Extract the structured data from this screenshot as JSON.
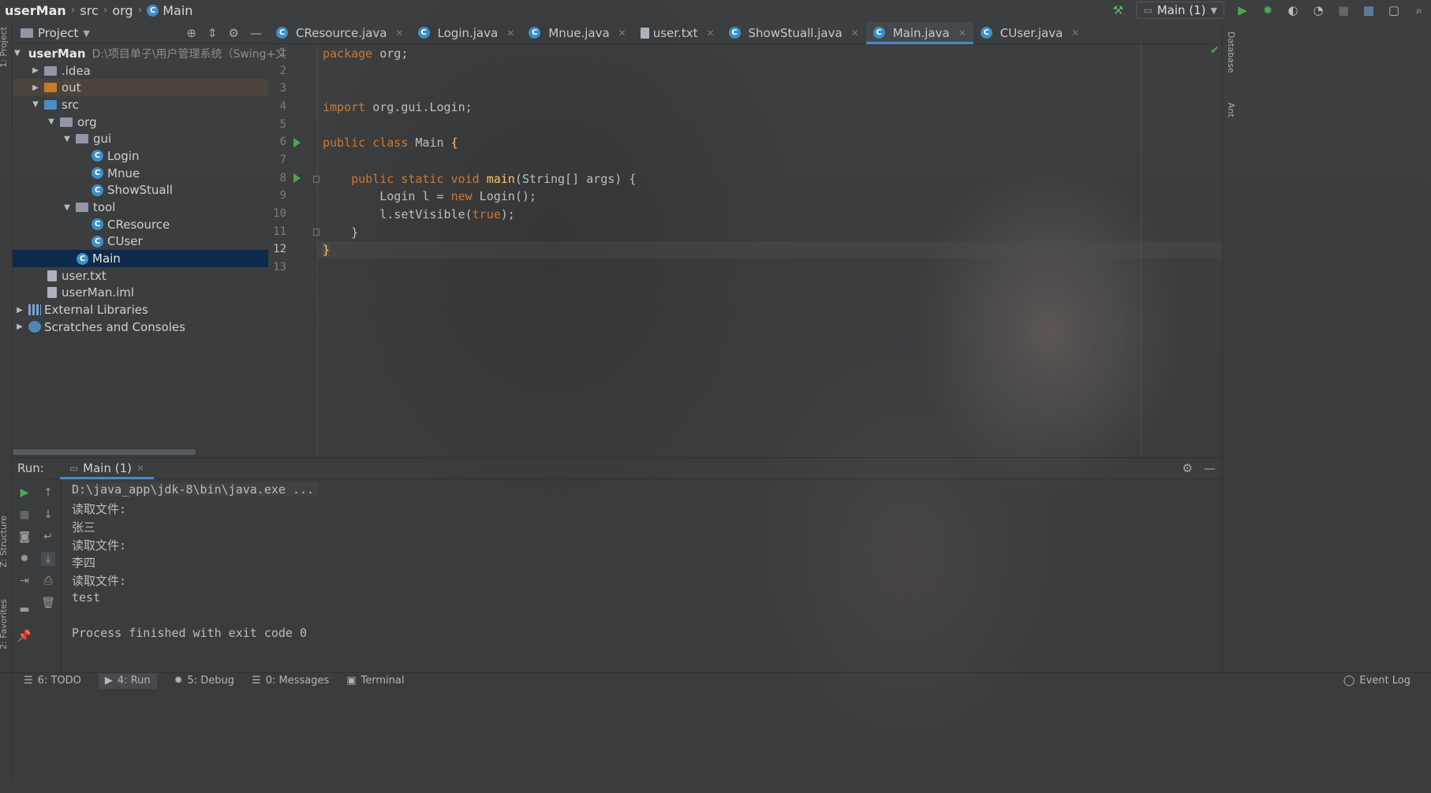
{
  "breadcrumb": {
    "project": "userMan",
    "p1": "src",
    "p2": "org",
    "p3": "Main"
  },
  "toolbar": {
    "run_config": "Main (1)"
  },
  "left_strip": {
    "project_label": "1: Project",
    "structure_label": "Z: Structure",
    "favorites_label": "2: Favorites"
  },
  "right_strip": {
    "database_label": "Database",
    "ant_label": "Ant"
  },
  "project_panel": {
    "title": "Project",
    "root_path": "D:\\项目单子\\用户管理系统（Swing+文",
    "items": [
      {
        "label": "userMan"
      },
      {
        "label": ".idea"
      },
      {
        "label": "out"
      },
      {
        "label": "src"
      },
      {
        "label": "org"
      },
      {
        "label": "gui"
      },
      {
        "label": "Login"
      },
      {
        "label": "Mnue"
      },
      {
        "label": "ShowStuall"
      },
      {
        "label": "tool"
      },
      {
        "label": "CResource"
      },
      {
        "label": "CUser"
      },
      {
        "label": "Main"
      },
      {
        "label": "user.txt"
      },
      {
        "label": "userMan.iml"
      },
      {
        "label": "External Libraries"
      },
      {
        "label": "Scratches and Consoles"
      }
    ]
  },
  "tabs": [
    {
      "label": "CResource.java"
    },
    {
      "label": "Login.java"
    },
    {
      "label": "Mnue.java"
    },
    {
      "label": "user.txt"
    },
    {
      "label": "ShowStuall.java"
    },
    {
      "label": "Main.java"
    },
    {
      "label": "CUser.java"
    }
  ],
  "editor": {
    "line_numbers": [
      "1",
      "2",
      "3",
      "4",
      "5",
      "6",
      "7",
      "8",
      "9",
      "10",
      "11",
      "12",
      "13"
    ],
    "current_line": "12",
    "code": {
      "l1_kw": "package",
      "l1_rest": " org;",
      "l4_kw": "import",
      "l4_rest": " org.gui.Login;",
      "l6_kw": "public class",
      "l6_name": " Main ",
      "l6_brace": "{",
      "l8_kw": "    public static void",
      "l8_fn": " main",
      "l8_rest": "(String[] args) {",
      "l9_a": "        Login l = ",
      "l9_kw": "new",
      "l9_b": " Login();",
      "l10_a": "        l.setVisible(",
      "l10_kw": "true",
      "l10_b": ");",
      "l11": "    }",
      "l12": "}"
    }
  },
  "run_panel": {
    "label": "Run:",
    "tab": "Main (1)",
    "console": [
      "D:\\java_app\\jdk-8\\bin\\java.exe ...",
      "读取文件:",
      "张三",
      "读取文件:",
      "李四",
      "读取文件:",
      "test",
      "",
      "Process finished with exit code 0"
    ]
  },
  "bottom_bar": {
    "todo": "6: TODO",
    "run": "4: Run",
    "debug": "5: Debug",
    "messages": "0: Messages",
    "terminal": "Terminal",
    "event_log": "Event Log"
  },
  "colors": {
    "accent": "#4a88c7",
    "selection": "#0d2a4a",
    "keyword": "#cc7832",
    "function": "#ffc66d",
    "run_green": "#4caa4c"
  }
}
